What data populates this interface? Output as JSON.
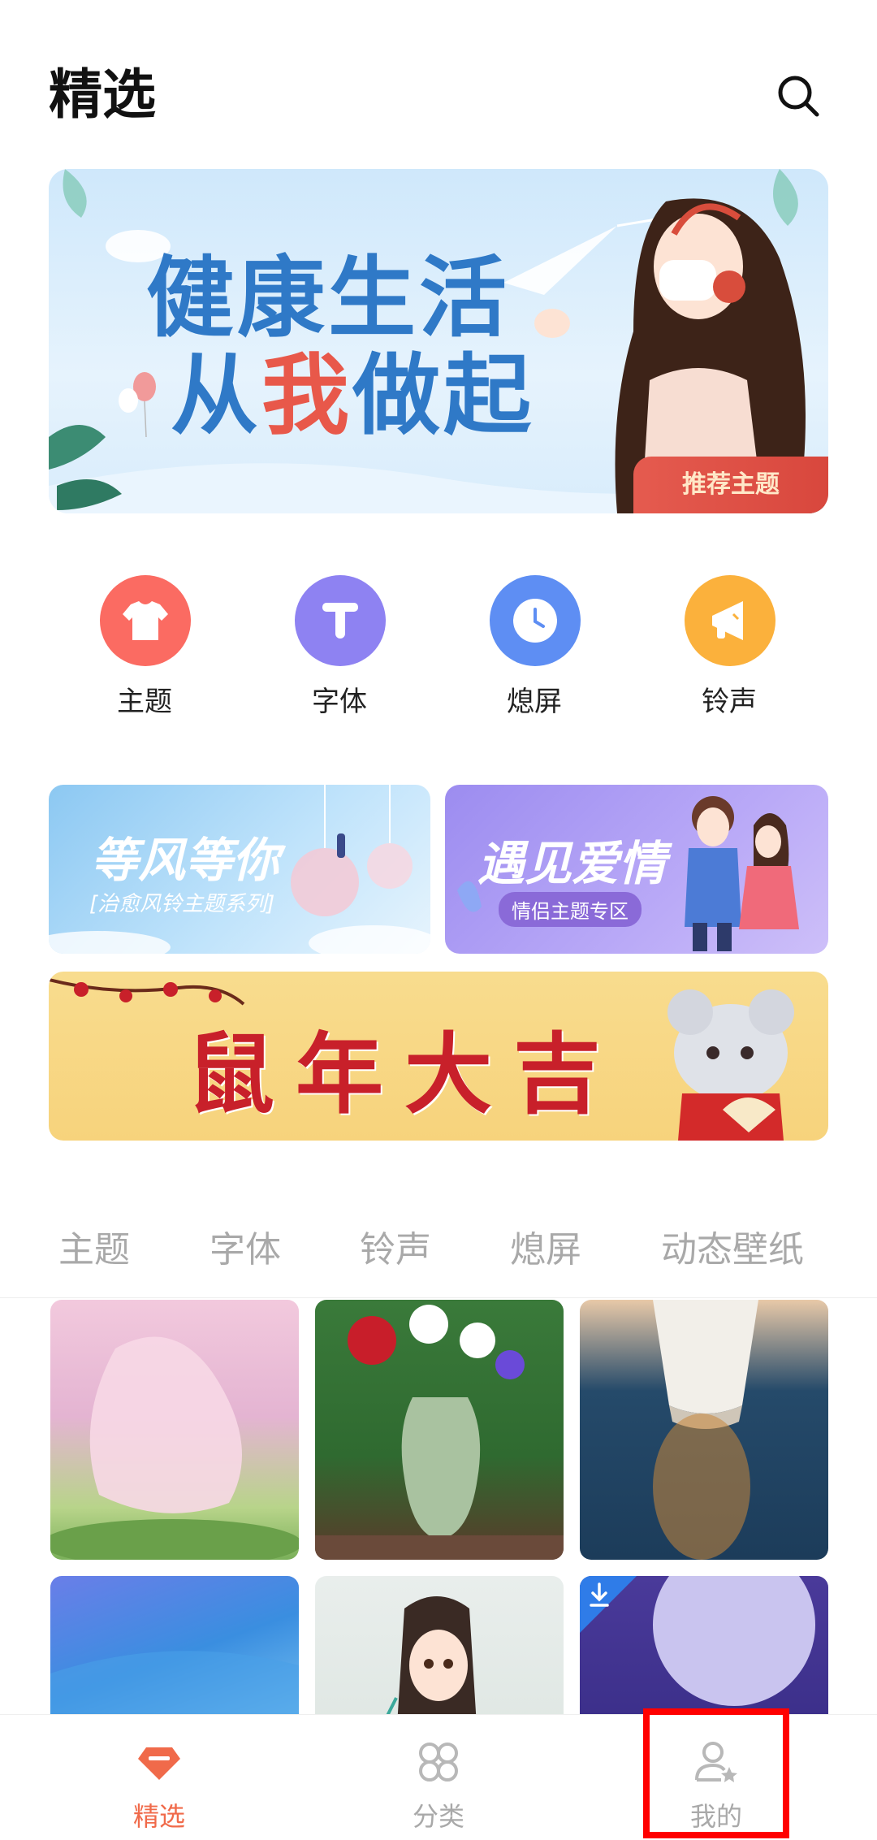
{
  "header": {
    "title": "精选",
    "search_icon": "search-icon"
  },
  "hero": {
    "line1": "健康生活",
    "line2_part1": "从",
    "line2_accent": "我",
    "line2_part2": "做起",
    "badge": "推荐主题"
  },
  "quick": [
    {
      "label": "主题",
      "icon": "tshirt-icon",
      "color": "#fb6b62"
    },
    {
      "label": "字体",
      "icon": "font-t-icon",
      "color": "#8e82f2"
    },
    {
      "label": "熄屏",
      "icon": "clock-icon",
      "color": "#5e8ef3"
    },
    {
      "label": "铃声",
      "icon": "megaphone-icon",
      "color": "#fbb13c"
    }
  ],
  "promos": {
    "wind": {
      "title": "等风等你",
      "subtitle": "[治愈风铃主题系列]"
    },
    "love": {
      "title": "遇见爱情",
      "subtitle": "情侣主题专区"
    },
    "rat": {
      "title": "鼠年大吉"
    }
  },
  "tabs": [
    "主题",
    "字体",
    "铃声",
    "熄屏",
    "动态壁纸"
  ],
  "grid_icons": {
    "download": "download-icon"
  },
  "bottom_nav": [
    {
      "label": "精选",
      "icon": "gem-icon",
      "active": true
    },
    {
      "label": "分类",
      "icon": "grid-icon",
      "active": false
    },
    {
      "label": "我的",
      "icon": "profile-icon",
      "active": false
    }
  ],
  "colors": {
    "accent": "#f06a4a",
    "inactive": "#a9a9a9",
    "hero_text": "#2f79c7",
    "highlight": "#ff0000"
  }
}
